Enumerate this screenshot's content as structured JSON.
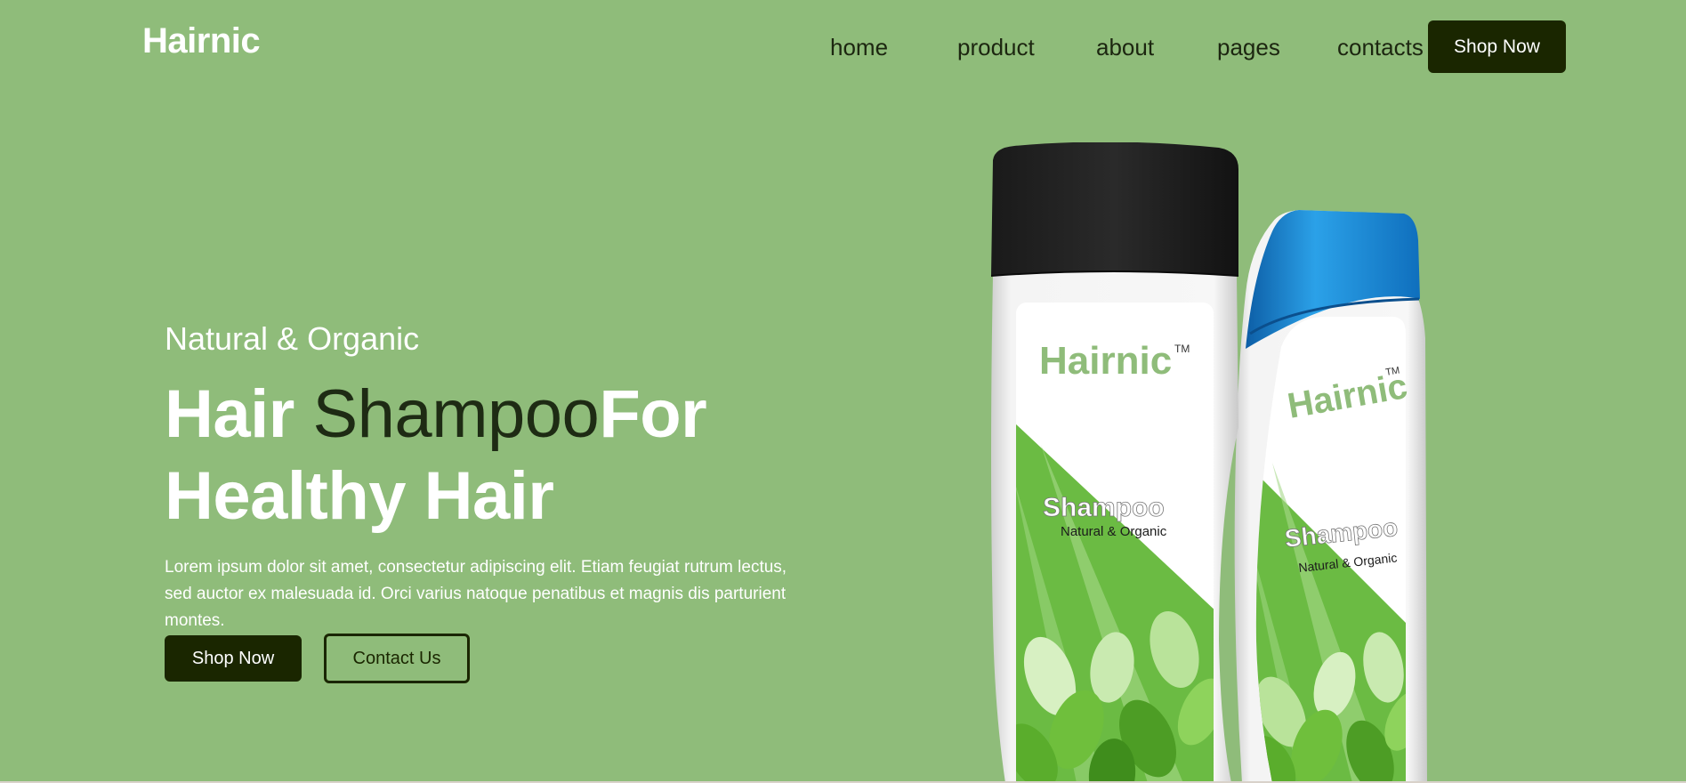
{
  "header": {
    "logo": "Hairnic",
    "nav": [
      "home",
      "product",
      "about",
      "pages",
      "contacts"
    ],
    "shop_button": "Shop Now"
  },
  "hero": {
    "kicker": "Natural & Organic",
    "headline_bold1": "Hair ",
    "headline_light": "Shampoo",
    "headline_bold2": "For",
    "headline_line2": "Healthy Hair",
    "description": "Lorem ipsum dolor sit amet, consectetur adipiscing elit. Etiam feugiat rutrum lectus, sed auctor ex malesuada id. Orci varius natoque penatibus et magnis dis parturient montes.",
    "shop_button": "Shop Now",
    "contact_button": "Contact Us"
  },
  "product_image": {
    "brand": "Hairnic",
    "trademark": "TM",
    "product_name": "Shampoo",
    "tagline": "Natural & Organic"
  },
  "colors": {
    "background": "#8fbc7a",
    "dark": "#1a2600",
    "brand_green": "#8fbc7a",
    "cap_blue": "#1f8fd6",
    "cap_black": "#1b1b1b"
  }
}
